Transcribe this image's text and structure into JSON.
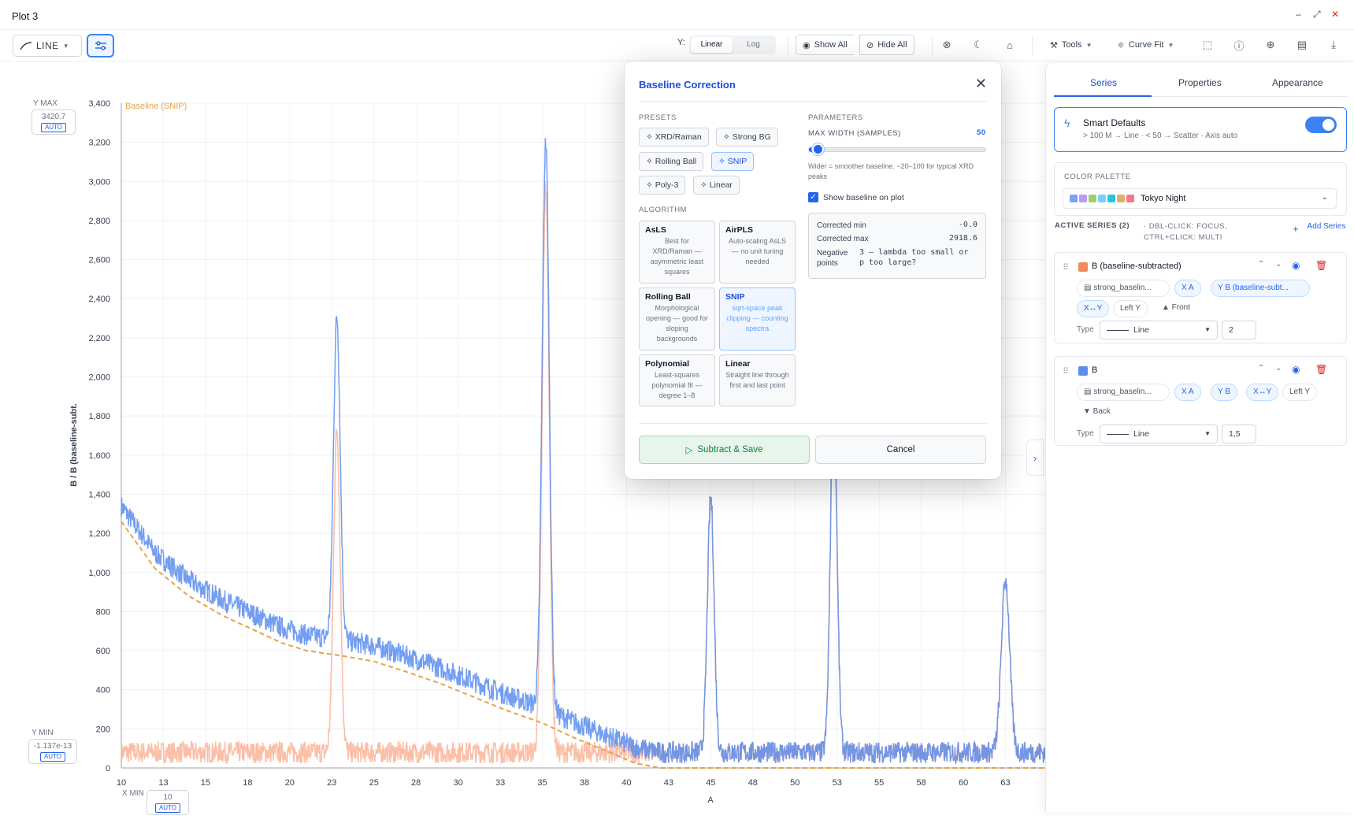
{
  "window": {
    "title": "Plot 3",
    "controls": [
      "–",
      "⤢",
      "✕"
    ]
  },
  "toolbar": {
    "chart_type_label": "LINE",
    "y_scale_label": "Y:",
    "y_scale_options": [
      "Linear",
      "Log"
    ],
    "show_all": "Show All",
    "hide_all": "Hide All",
    "tools": "Tools",
    "curve_fit": "Curve Fit"
  },
  "axis_boxes": {
    "ymax_caption": "Y MAX",
    "ymax_value": "3420.7",
    "ymin_caption": "Y MIN",
    "ymin_value": "-1.137e-13",
    "xmin_caption": "X MIN",
    "xmin_value": "10",
    "auto_label": "AUTO"
  },
  "chart_data": {
    "type": "line",
    "xlabel": "A",
    "ylabel": "B / B (baseline-subt.",
    "annotation": "Baseline (SNIP)",
    "xlim": [
      10,
      65
    ],
    "ylim": [
      0,
      3400
    ],
    "x_ticks": [
      "10",
      "13",
      "15",
      "18",
      "20",
      "23",
      "25",
      "28",
      "30",
      "33",
      "35",
      "38",
      "40",
      "43",
      "45",
      "48",
      "50",
      "53",
      "55",
      "58",
      "60",
      "63"
    ],
    "x_tick_values": [
      10,
      12.5,
      15,
      17.5,
      20,
      22.5,
      25,
      27.5,
      30,
      32.5,
      35,
      37.5,
      40,
      42.5,
      45,
      47.5,
      50,
      52.5,
      55,
      57.5,
      60,
      62.5
    ],
    "y_ticks": [
      0,
      200,
      400,
      600,
      800,
      1000,
      1200,
      1400,
      1600,
      1800,
      2000,
      2200,
      2400,
      2600,
      2800,
      3000,
      3200,
      3400
    ],
    "baseline_points": [
      [
        10,
        1260
      ],
      [
        12,
        1020
      ],
      [
        14,
        880
      ],
      [
        16,
        780
      ],
      [
        18,
        700
      ],
      [
        19.5,
        640
      ],
      [
        21,
        600
      ],
      [
        23,
        575
      ],
      [
        25,
        545
      ],
      [
        27,
        490
      ],
      [
        29,
        430
      ],
      [
        31,
        360
      ],
      [
        33,
        290
      ],
      [
        35,
        230
      ],
      [
        37,
        150
      ],
      [
        39,
        80
      ],
      [
        40.5,
        25
      ],
      [
        42,
        0
      ],
      [
        65,
        0
      ]
    ],
    "peaks": [
      {
        "x": 22.8,
        "height": 1650,
        "width": 0.28
      },
      {
        "x": 35.2,
        "height": 2900,
        "width": 0.3
      },
      {
        "x": 45.0,
        "height": 1300,
        "width": 0.28
      },
      {
        "x": 52.3,
        "height": 1800,
        "width": 0.28
      },
      {
        "x": 62.5,
        "height": 880,
        "width": 0.35
      }
    ],
    "noise_level": 55,
    "series": [
      {
        "name": "B (baseline-subtracted)",
        "color": "#f9a98b"
      },
      {
        "name": "B",
        "color": "#5b8def"
      },
      {
        "name": "Baseline (SNIP)",
        "color": "#e8a24a"
      }
    ]
  },
  "modal": {
    "title": "Baseline Correction",
    "presets_label": "PRESETS",
    "presets": [
      "XRD/Raman",
      "Strong BG",
      "Rolling Ball",
      "SNIP",
      "Poly-3",
      "Linear"
    ],
    "selected_preset": "SNIP",
    "algorithm_label": "ALGORITHM",
    "algorithms": [
      {
        "name": "AsLS",
        "desc": "Best for XRD/Raman — asymmetric least squares"
      },
      {
        "name": "AirPLS",
        "desc": "Auto-scaling AsLS — no unit tuning needed"
      },
      {
        "name": "Rolling Ball",
        "desc": "Morphological opening — good for sloping backgrounds"
      },
      {
        "name": "SNIP",
        "desc": "sqrt-space peak clipping — counting spectra"
      },
      {
        "name": "Polynomial",
        "desc": "Least-squares polynomial fit — degree 1–8"
      },
      {
        "name": "Linear",
        "desc": "Straight line through first and last point"
      }
    ],
    "selected_algorithm": "SNIP",
    "parameters_label": "PARAMETERS",
    "max_width_label": "MAX WIDTH (SAMPLES)",
    "max_width_value": "50",
    "max_width_fraction": 0.05,
    "hint": "Wider = smoother baseline. ~20–100 for typical XRD peaks",
    "show_baseline_label": "Show baseline on plot",
    "show_baseline": true,
    "stats": {
      "corrected_min_label": "Corrected min",
      "corrected_min": "-0.0",
      "corrected_max_label": "Corrected max",
      "corrected_max": "2918.6",
      "negative_label": "Negative points",
      "negative_value": "3 — lambda too small or p too large?"
    },
    "subtract_save": "Subtract & Save",
    "cancel": "Cancel"
  },
  "sidebar": {
    "tabs": [
      "Series",
      "Properties",
      "Appearance"
    ],
    "active_tab": "Series",
    "smart_defaults_title": "Smart Defaults",
    "smart_defaults_desc": "> 100 M → Line · < 50 → Scatter · Axis auto",
    "smart_defaults_on": true,
    "palette_label": "COLOR PALETTE",
    "palette_name": "Tokyo Night",
    "palette_colors": [
      "#7aa2f7",
      "#bb9af7",
      "#9ece6a",
      "#7dcfff",
      "#2ac3de",
      "#e0af68",
      "#f7768e"
    ],
    "active_series_label": "ACTIVE SERIES (2)",
    "active_series_hint": "· DBL-CLICK: FOCUS, CTRL+CLICK: MULTI",
    "add_series": "Add Series",
    "series": [
      {
        "name": "B (baseline-subtracted)",
        "color": "#f08c5a",
        "source": "strong_baselin...",
        "x": "X A",
        "y": "Y B (baseline-subt...",
        "swap": "X↔Y",
        "axis": "Left Y",
        "order": "▲ Front",
        "type_label": "Type",
        "type": "Line",
        "width": "2"
      },
      {
        "name": "B",
        "color": "#5b8def",
        "source": "strong_baselin...",
        "x": "X A",
        "y": "Y B",
        "swap": "X↔Y",
        "axis": "Left Y",
        "order": "▼ Back",
        "type_label": "Type",
        "type": "Line",
        "width": "1,5"
      }
    ]
  }
}
